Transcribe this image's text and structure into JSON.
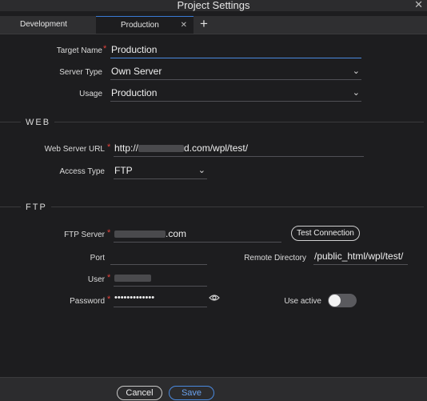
{
  "window": {
    "title": "Project Settings",
    "close_glyph": "✕"
  },
  "tabs": [
    {
      "label": "Development",
      "active": false
    },
    {
      "label": "Production",
      "active": true,
      "close_glyph": "✕"
    }
  ],
  "add_tab_glyph": "+",
  "general": {
    "target_name": {
      "label": "Target Name",
      "required": true,
      "value": "Production"
    },
    "server_type": {
      "label": "Server Type",
      "value": "Own Server"
    },
    "usage": {
      "label": "Usage",
      "value": "Production"
    }
  },
  "web": {
    "heading": "WEB",
    "url": {
      "label": "Web Server URL",
      "required": true,
      "prefix": "http://",
      "suffix": "d.com/wpl/test/"
    },
    "access_type": {
      "label": "Access Type",
      "value": "FTP"
    }
  },
  "ftp": {
    "heading": "FTP",
    "server": {
      "label": "FTP Server",
      "required": true,
      "suffix": ".com"
    },
    "test_connection": "Test Connection",
    "port": {
      "label": "Port",
      "value": ""
    },
    "remote_directory": {
      "label": "Remote Directory",
      "value": "/public_html/wpl/test/"
    },
    "user": {
      "label": "User",
      "required": true
    },
    "password": {
      "label": "Password",
      "required": true,
      "value": "•••••••••••••"
    },
    "use_active": {
      "label": "Use active",
      "on": false
    }
  },
  "footer": {
    "cancel": "Cancel",
    "save": "Save"
  },
  "colors": {
    "accent": "#4a8ae0",
    "required": "#e0413a",
    "background": "#1d1d1f"
  },
  "icons": [
    "chevron-down-icon",
    "eye-icon",
    "close-icon",
    "plus-icon"
  ]
}
